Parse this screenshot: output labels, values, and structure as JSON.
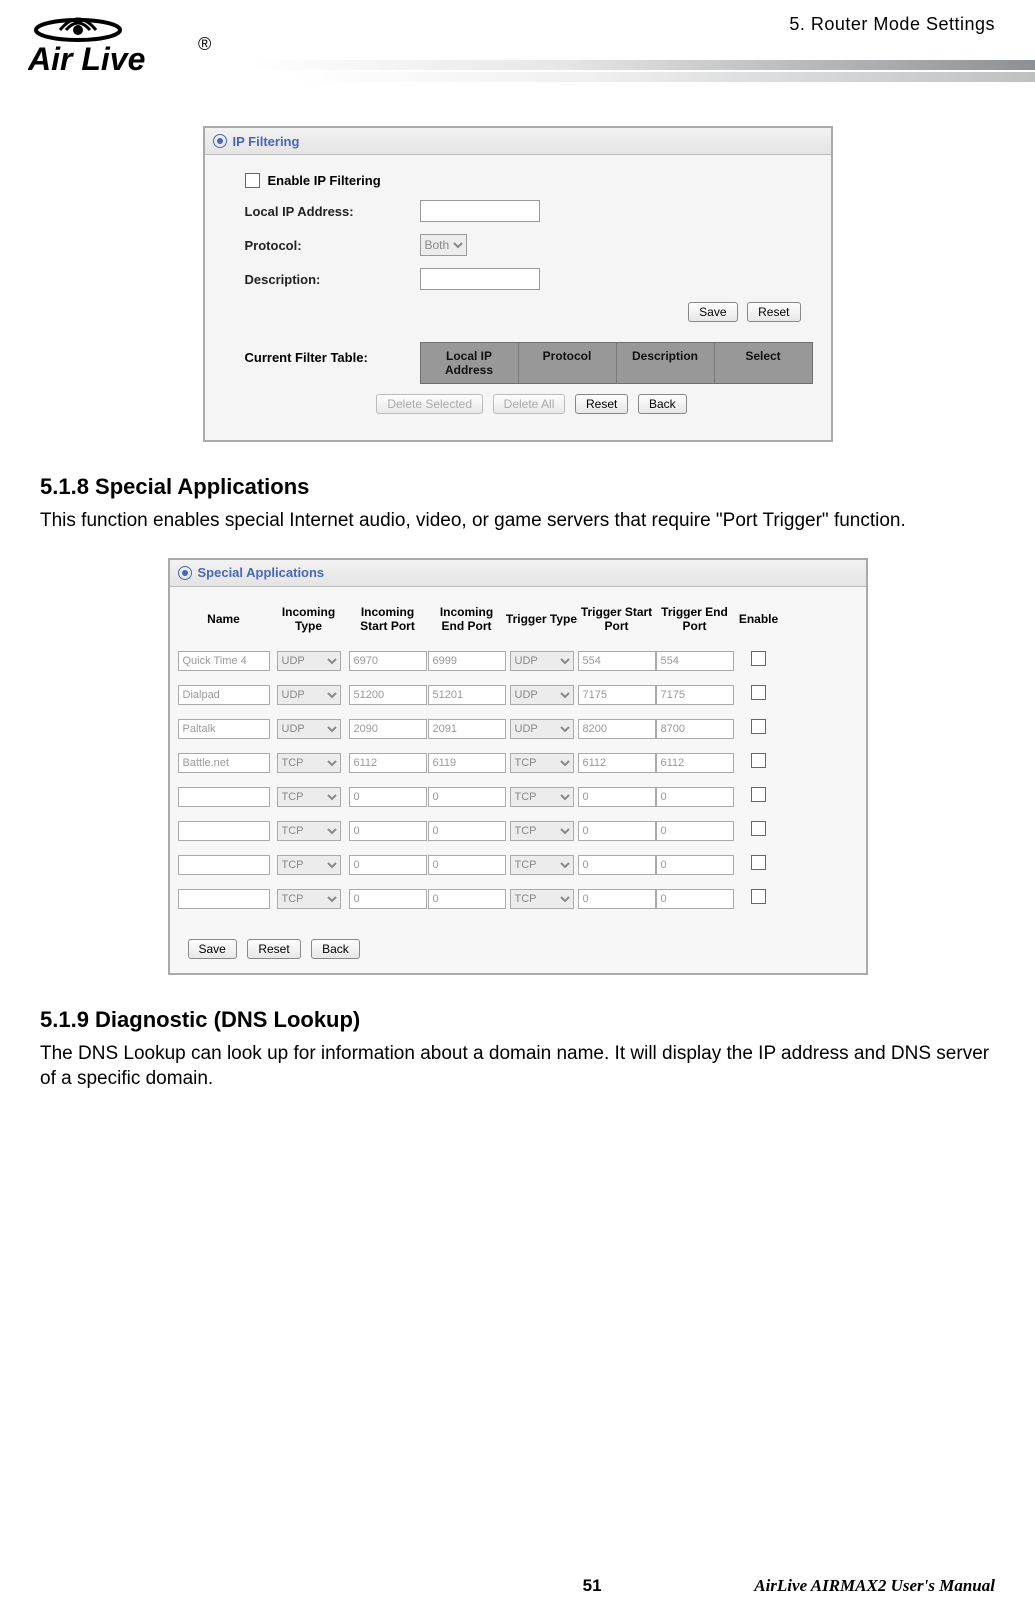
{
  "header": {
    "chapter": "5.  Router Mode Settings"
  },
  "ipfilter": {
    "title": "IP Filtering",
    "enable_label": "Enable IP Filtering",
    "local_ip_label": "Local IP Address:",
    "protocol_label": "Protocol:",
    "protocol_value": "Both",
    "description_label": "Description:",
    "save": "Save",
    "reset": "Reset",
    "table_label": "Current Filter Table:",
    "th_local": "Local IP Address",
    "th_proto": "Protocol",
    "th_desc": "Description",
    "th_select": "Select",
    "delete_selected": "Delete Selected",
    "delete_all": "Delete All",
    "reset2": "Reset",
    "back": "Back"
  },
  "sec518": {
    "title": "5.1.8 Special Applications",
    "body": "This function enables special Internet audio, video, or game servers that require \"Port Trigger\" function."
  },
  "sa": {
    "title": "Special Applications",
    "th_name": "Name",
    "th_itype": "Incoming Type",
    "th_is": "Incoming Start Port",
    "th_ie": "Incoming End Port",
    "th_ttype": "Trigger Type",
    "th_ts": "Trigger Start Port",
    "th_te": "Trigger End Port",
    "th_en": "Enable",
    "rows": [
      {
        "name": "Quick Time 4",
        "itype": "UDP",
        "is": "6970",
        "ie": "6999",
        "ttype": "UDP",
        "ts": "554",
        "te": "554"
      },
      {
        "name": "Dialpad",
        "itype": "UDP",
        "is": "51200",
        "ie": "51201",
        "ttype": "UDP",
        "ts": "7175",
        "te": "7175"
      },
      {
        "name": "Paltalk",
        "itype": "UDP",
        "is": "2090",
        "ie": "2091",
        "ttype": "UDP",
        "ts": "8200",
        "te": "8700"
      },
      {
        "name": "Battle.net",
        "itype": "TCP",
        "is": "6112",
        "ie": "6119",
        "ttype": "TCP",
        "ts": "6112",
        "te": "6112"
      },
      {
        "name": "",
        "itype": "TCP",
        "is": "0",
        "ie": "0",
        "ttype": "TCP",
        "ts": "0",
        "te": "0"
      },
      {
        "name": "",
        "itype": "TCP",
        "is": "0",
        "ie": "0",
        "ttype": "TCP",
        "ts": "0",
        "te": "0"
      },
      {
        "name": "",
        "itype": "TCP",
        "is": "0",
        "ie": "0",
        "ttype": "TCP",
        "ts": "0",
        "te": "0"
      },
      {
        "name": "",
        "itype": "TCP",
        "is": "0",
        "ie": "0",
        "ttype": "TCP",
        "ts": "0",
        "te": "0"
      }
    ],
    "save": "Save",
    "reset": "Reset",
    "back": "Back"
  },
  "sec519": {
    "title": "5.1.9 Diagnostic (DNS Lookup)",
    "body": "The DNS Lookup can look up for information about a domain name.   It will display the IP address and DNS server of a specific domain."
  },
  "footer": {
    "page": "51",
    "manual": "AirLive AIRMAX2 User's Manual"
  }
}
